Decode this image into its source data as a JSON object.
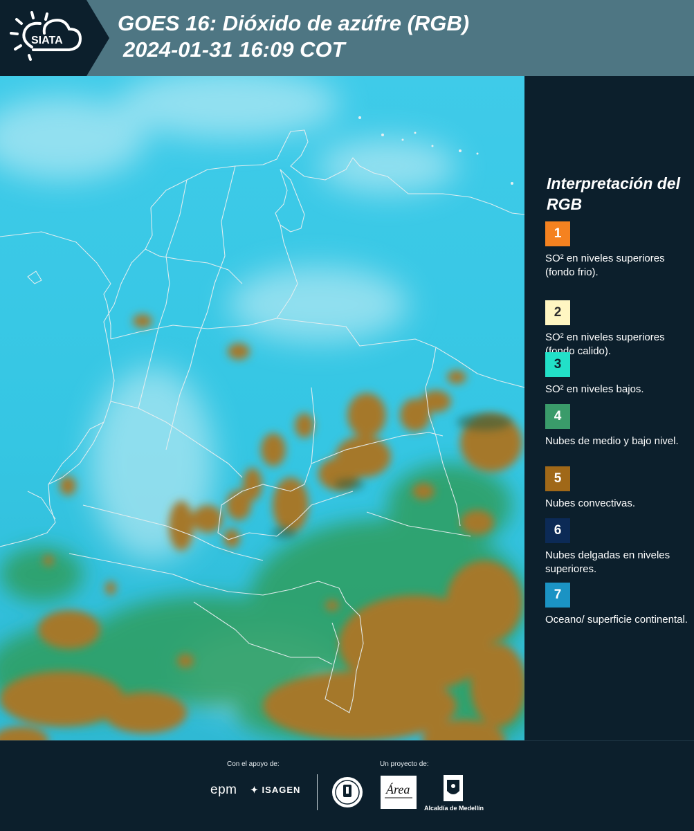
{
  "header": {
    "logo_text": "SIATA",
    "title_line1": "GOES 16: Dióxido de azúfre (RGB)",
    "title_line2": "2024-01-31 16:09 COT"
  },
  "colors": {
    "background": "#0c1f2c",
    "header_band": "#4e7683",
    "map_sky": "#37c8e6",
    "cloud_mid_low": "#2f9e5f",
    "cloud_convective": "#a5782c",
    "borders": "#e6eef0"
  },
  "legend": {
    "title": "Interpretación del RGB",
    "items": [
      {
        "number": "1",
        "color": "#f58220",
        "text_color": "#ffffff",
        "label": "SO² en niveles superiores (fondo frio)."
      },
      {
        "number": "2",
        "color": "#fff6c2",
        "text_color": "#2c2c2c",
        "label": "SO² en niveles superiores (fondo calido)."
      },
      {
        "number": "3",
        "color": "#22e0c8",
        "text_color": "#0c1f2c",
        "label": "SO² en niveles bajos."
      },
      {
        "number": "4",
        "color": "#3a9b6a",
        "text_color": "#ffffff",
        "label": "Nubes de medio y bajo nivel."
      },
      {
        "number": "5",
        "color": "#a06818",
        "text_color": "#ffffff",
        "label": "Nubes convectivas."
      },
      {
        "number": "6",
        "color": "#0c2a56",
        "text_color": "#ffffff",
        "label": "Nubes delgadas en niveles superiores."
      },
      {
        "number": "7",
        "color": "#1b93c4",
        "text_color": "#ffffff",
        "label": "Oceano/ superficie continental."
      }
    ]
  },
  "footer": {
    "support_label": "Con el apoyo de:",
    "project_label": "Un proyecto de:",
    "sponsor_epm": "epm",
    "sponsor_isagen": "ISAGEN",
    "partner_area": "Área",
    "partner_alcaldia": "Alcaldía de Medellín"
  }
}
